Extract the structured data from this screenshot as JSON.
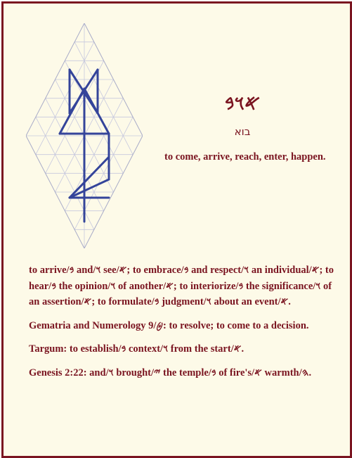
{
  "card": {
    "word_glyphs": "𐤀𐤅𐤁",
    "hebrew": "בוא",
    "meaning": "to come, arrive, reach, enter, happen.",
    "colors": {
      "border": "#7a1420",
      "text": "#7a1420",
      "background": "#fdfae8",
      "grid": "#c6c8de",
      "diagram_stroke": "#34449a"
    }
  },
  "paragraphs": [
    "to arrive/𐤁 and/𐤅 see/𐤀; to embrace/𐤁 and respect/𐤅 an individual/𐤀; to hear/𐤁 the opinion/𐤅 of another/𐤀; to interiorize/𐤁 the significance/𐤅 of an assertion/𐤀; to formulate/𐤁 judgment/𐤅 about an event/𐤀.",
    "Gematria and Numerology 9/𐤈: to resolve; to come to a decision.",
    "Targum: to establish/𐤁 context/𐤅 from the start/𐤀.",
    "Genesis 2:22: and/𐤅 brought/𐤉 the temple/𐤁 of fire's/𐤀 warmth/𐤄."
  ]
}
